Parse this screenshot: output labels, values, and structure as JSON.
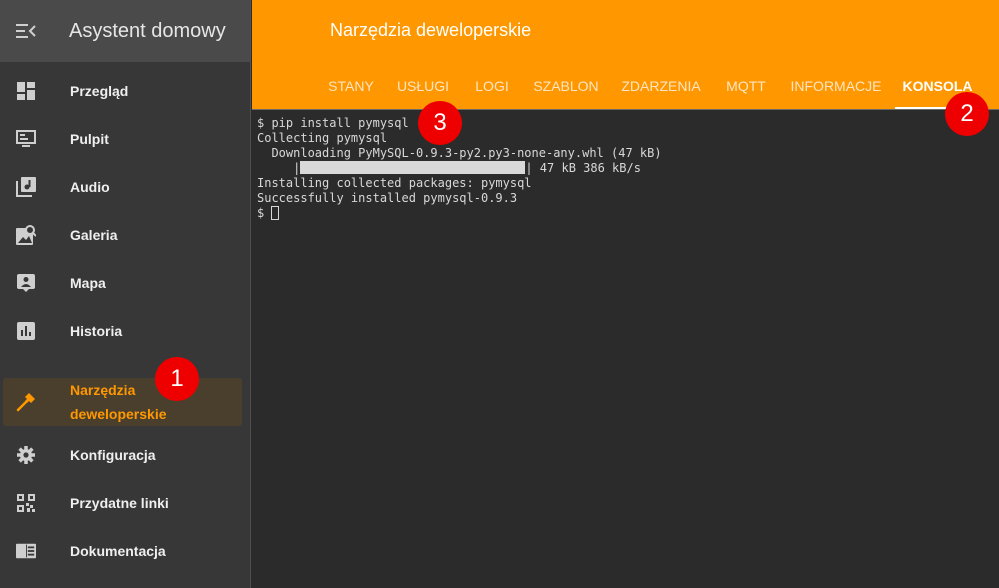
{
  "app": {
    "title": "Asystent domowy"
  },
  "sidebar": {
    "items": [
      {
        "label": "Przegląd",
        "icon": "dashboard-icon"
      },
      {
        "label": "Pulpit",
        "icon": "monitor-icon"
      },
      {
        "label": "Audio",
        "icon": "music-library-icon"
      },
      {
        "label": "Galeria",
        "icon": "image-search-icon"
      },
      {
        "label": "Mapa",
        "icon": "account-box-icon"
      },
      {
        "label": "Historia",
        "icon": "chart-box-icon"
      },
      {
        "label_line1": "Narzędzia",
        "label_line2": "deweloperskie",
        "icon": "hammer-icon",
        "active": true
      },
      {
        "label": "Konfiguracja",
        "icon": "gear-icon"
      },
      {
        "label": "Przydatne linki",
        "icon": "qrcode-icon"
      },
      {
        "label": "Dokumentacja",
        "icon": "book-icon"
      }
    ]
  },
  "header": {
    "title": "Narzędzia deweloperskie",
    "tabs": [
      {
        "label": "STANY"
      },
      {
        "label": "USŁUGI"
      },
      {
        "label": "LOGI"
      },
      {
        "label": "SZABLON"
      },
      {
        "label": "ZDARZENIA"
      },
      {
        "label": "MQTT"
      },
      {
        "label": "INFORMACJE"
      },
      {
        "label": "KONSOLA",
        "active": true
      }
    ]
  },
  "console": {
    "lines": [
      "$ pip install pymysql",
      "Collecting pymysql",
      "  Downloading PyMySQL-0.9.3-py2.py3-none-any.whl (47 kB)",
      "| 47 kB 386 kB/s",
      "Installing collected packages: pymysql",
      "Successfully installed pymysql-0.9.3",
      "$ "
    ],
    "progress_prefix": "     |",
    "progress_suffix": "| 47 kB 386 kB/s"
  },
  "badges": [
    "1",
    "2",
    "3"
  ],
  "colors": {
    "accent": "#ff9800",
    "badge": "#ee0000",
    "sidebar": "#373737",
    "console": "#2b2b2b"
  }
}
